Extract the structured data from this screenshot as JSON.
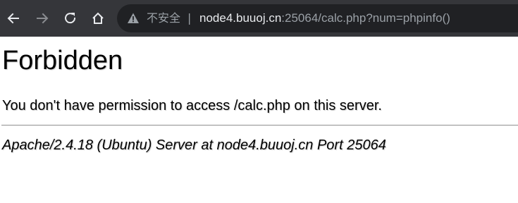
{
  "browser": {
    "security_label": "不安全",
    "separator": "|",
    "url_host": "node4.buuoj.cn",
    "url_rest": ":25064/calc.php?num=phpinfo()",
    "colors": {
      "toolbar_bg": "#35363a",
      "omnibox_bg": "#202124",
      "url_host": "#e8eaed",
      "url_rest": "#9aa0a6"
    },
    "icons": [
      "back-arrow-icon",
      "forward-arrow-icon",
      "reload-icon",
      "home-icon",
      "warning-icon"
    ]
  },
  "page": {
    "title": "Forbidden",
    "message": "You don't have permission to access /calc.php on this server.",
    "server_signature": "Apache/2.4.18 (Ubuntu) Server at node4.buuoj.cn Port 25064"
  }
}
